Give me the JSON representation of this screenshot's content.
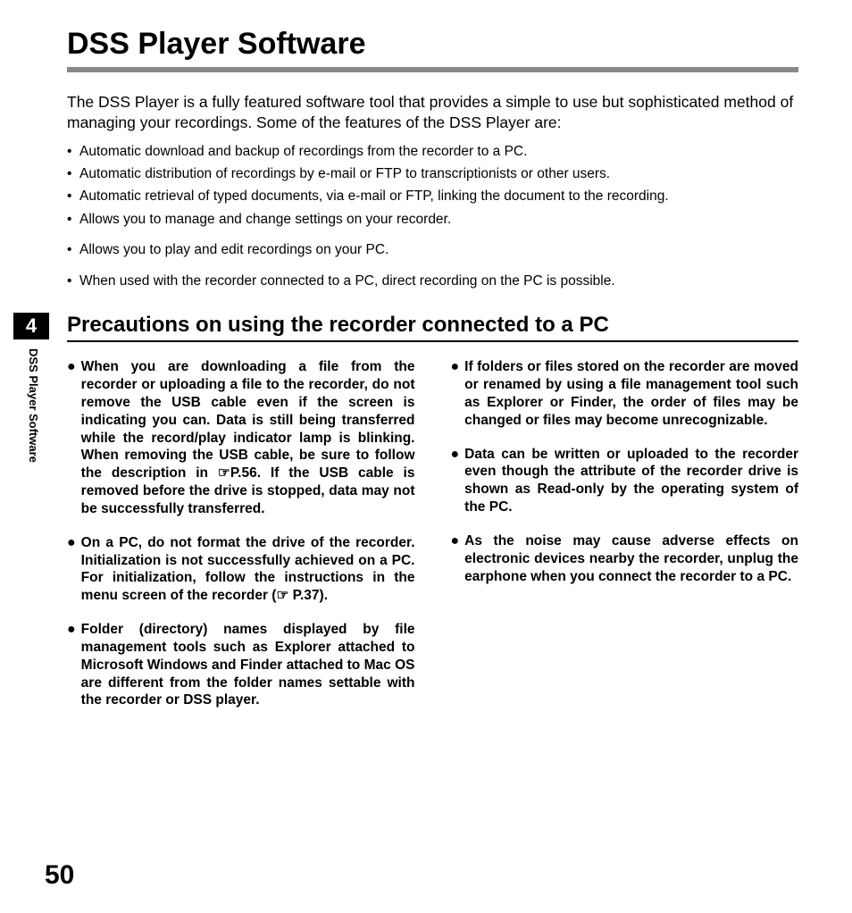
{
  "title": "DSS Player Software",
  "intro": "The DSS Player is a fully featured software tool that provides a simple to use but sophisticated method of managing your recordings. Some of the features of the DSS Player are:",
  "features": [
    "Automatic download and backup of recordings from the recorder to a PC.",
    "Automatic distribution of recordings by e-mail or FTP to transcriptionists or other users.",
    "Automatic retrieval of typed documents, via e-mail or FTP, linking the document to the recording.",
    "Allows you to manage and change settings on your recorder.",
    "Allows you to play and edit recordings on your PC.",
    "When used with the recorder connected to a PC, direct recording on the PC is possible."
  ],
  "chapter_number": "4",
  "section_heading": "Precautions on using the recorder connected to a PC",
  "side_tab": "DSS Player Software",
  "precautions_left": [
    "When you are downloading a file from the recorder or uploading a file to the recorder, do not remove the USB cable even if the screen is indicating you can. Data is still being transferred while the record/play indicator lamp is blinking. When removing the USB  cable, be sure to follow the description in ☞P.56. If the USB cable is removed before the drive is stopped, data may not be successfully transferred.",
    "On a PC, do not format the drive of the recorder. Initialization is not successfully achieved on a PC. For initialization, follow the instructions in the menu screen of the recorder (☞ P.37).",
    "Folder (directory) names displayed by file management tools such as Explorer attached to Microsoft Windows and Finder attached to Mac OS are different from the folder names settable with the recorder or DSS player."
  ],
  "precautions_right": [
    "If folders or files stored on the recorder are moved or renamed by using a file management tool such as Explorer or Finder, the order of files may be changed or files may become unrecognizable.",
    "Data can be written or uploaded to the recorder even though the attribute of the recorder drive is shown as Read-only by the operating system of the PC.",
    "As the noise may cause adverse effects on electronic devices nearby the recorder, unplug the earphone when you connect the recorder to a PC."
  ],
  "page_number": "50"
}
